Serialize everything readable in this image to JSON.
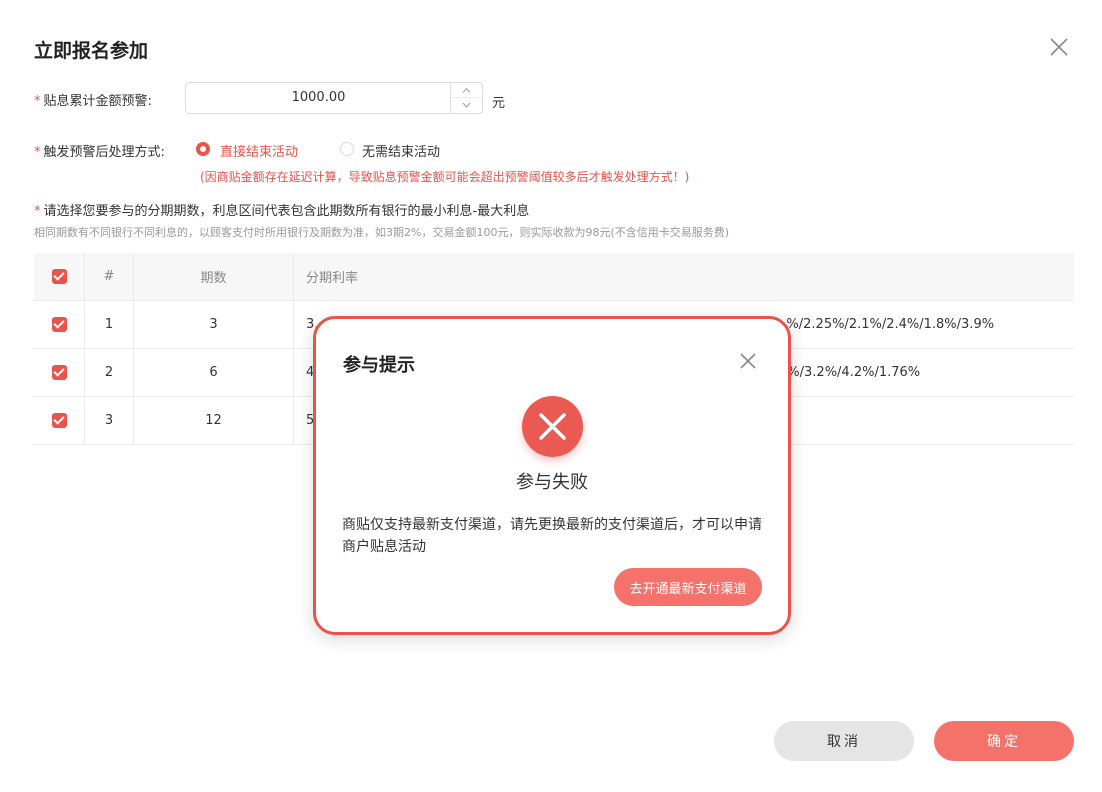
{
  "dialog": {
    "title": "立即报名参加"
  },
  "form": {
    "amount_label": "贴息累计金额预警:",
    "amount_value": "1000.00",
    "amount_unit": "元",
    "action_label": "触发预警后处理方式:",
    "option_direct": "直接结束活动",
    "option_none": "无需结束活动",
    "action_hint": "(因商贴金额存在延迟计算，导致贴息预警金额可能会超出预警阈值较多后才触发处理方式！)",
    "required_mark": "*"
  },
  "section": {
    "heading": "请选择您要参与的分期期数，利息区间代表包含此期数所有银行的最小利息-最大利息",
    "sub": "相同期数有不同银行不同利息的，以顾客支付时所用银行及期数为准，如3期2%，交易金额100元，则实际收款为98元(不含信用卡交易服务费)"
  },
  "table": {
    "headers": {
      "index": "#",
      "term": "期数",
      "rate": "分期利率"
    },
    "rows": [
      {
        "index": "1",
        "term": "3",
        "rate_start": "3.",
        "rate_end": "%/2.25%/2.1%/2.4%/1.8%/3.9%"
      },
      {
        "index": "2",
        "term": "6",
        "rate_start": "4",
        "rate_end": "%/3.2%/4.2%/1.76%"
      },
      {
        "index": "3",
        "term": "12",
        "rate_start": "5",
        "rate_end": ""
      }
    ]
  },
  "buttons": {
    "cancel": "取消",
    "ok": "确定"
  },
  "modal": {
    "title": "参与提示",
    "status": "参与失败",
    "message": "商贴仅支持最新支付渠道，请先更换最新的支付渠道后，才可以申请商户贴息活动",
    "action": "去开通最新支付渠道"
  },
  "colors": {
    "accent": "#e8534a",
    "button": "#f4726a"
  }
}
